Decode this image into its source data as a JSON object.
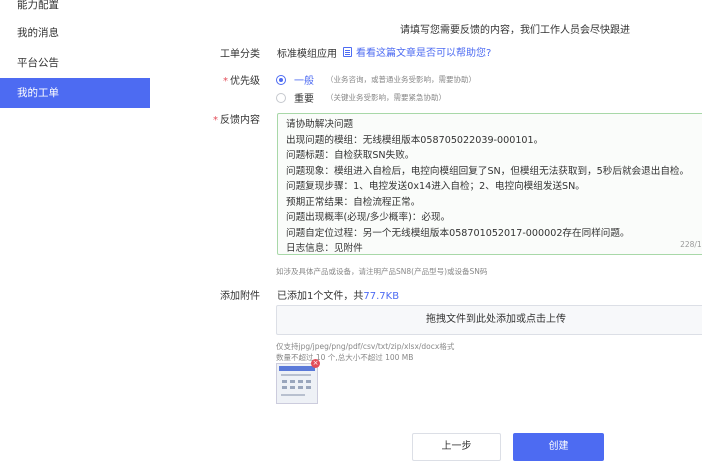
{
  "sidebar": {
    "items": [
      {
        "label": "能力配置"
      },
      {
        "label": "我的消息"
      },
      {
        "label": "平台公告"
      },
      {
        "label": "我的工单"
      }
    ]
  },
  "form": {
    "notice": "请填写您需要反馈的内容，我们工作人员会尽快跟进",
    "category": {
      "label": "工单分类",
      "value": "标准模组应用",
      "help_link": "看看这篇文章是否可以帮助您?"
    },
    "priority": {
      "label": "优先级",
      "options": [
        {
          "label": "一般",
          "desc": "（业务咨询，或普通业务受影响，需要协助）",
          "checked": true
        },
        {
          "label": "重要",
          "desc": "（关键业务受影响，需要紧急协助）",
          "checked": false
        }
      ]
    },
    "feedback": {
      "label": "反馈内容",
      "lines": [
        "请协助解决问题",
        "出现问题的模组：无线模组版本058705022039-000101。",
        "问题标题：自检获取SN失败。",
        "问题现象：模组进入自检后，电控向模组回复了SN，但模组无法获取到，5秒后就会退出自检。",
        "问题复现步骤：1、电控发送0x14进入自检；2、电控向模组发送SN。",
        "预期正常结果：自检流程正常。",
        "问题出现概率(必现/多少概率)：必现。",
        "问题自定位过程：另一个无线模组版本058701052017-000002存在同样问题。",
        "日志信息：见附件"
      ],
      "counter": "228/1000"
    },
    "hint": "如涉及具体产品或设备，请注明产品SN8(产品型号)或设备SN码",
    "attachment": {
      "label": "添加附件",
      "summary_prefix": "已添加1个文件，共",
      "summary_size": "77.7KB",
      "dropzone": "拖拽文件到此处添加或点击上传",
      "formats": "仅支持jpg/jpeg/png/pdf/csv/txt/zip/xlsx/docx格式",
      "limits": "数量不超过 10 个,总大小不超过 100 MB",
      "delete_symbol": "×"
    },
    "actions": {
      "prev": "上一步",
      "create": "创建"
    }
  },
  "colors": {
    "accent": "#4d6bf2",
    "required": "#e34d59",
    "textarea_border": "#a8d8a8"
  }
}
